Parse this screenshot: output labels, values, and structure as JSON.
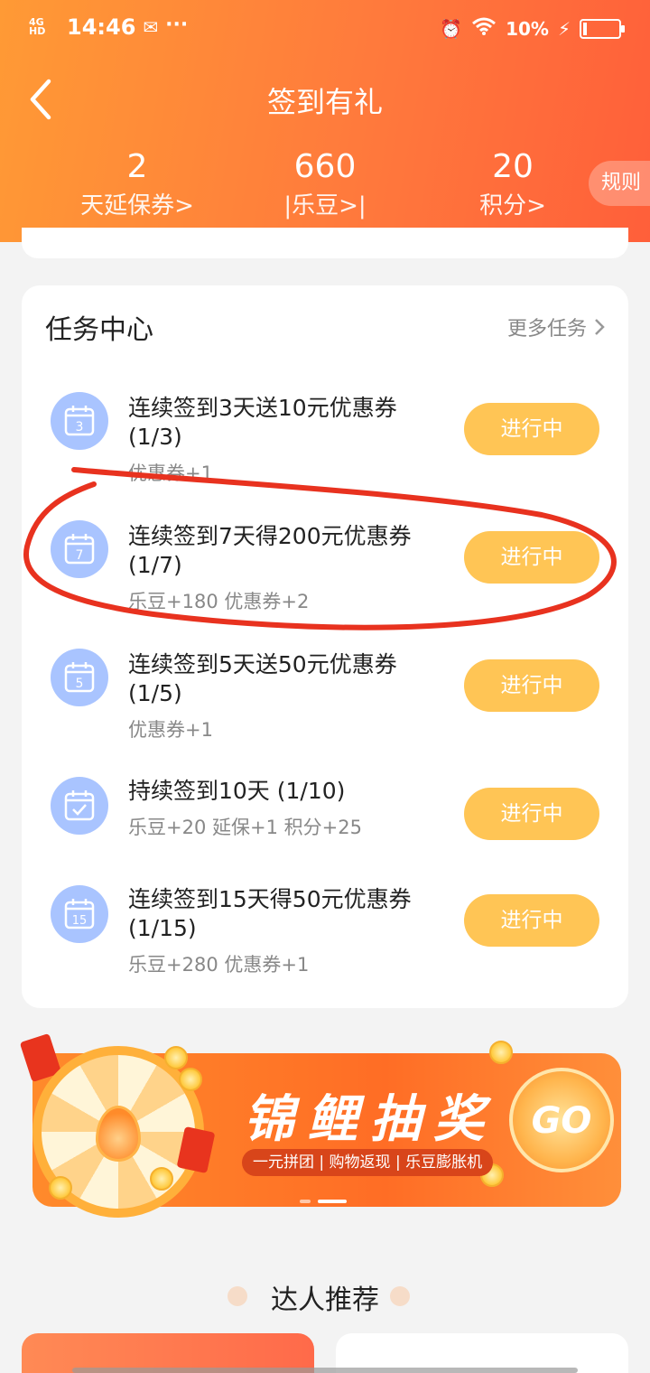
{
  "status_bar": {
    "network": "4G HD",
    "time": "14:46",
    "more": "···",
    "battery_text": "10%",
    "battery_level": 0.1
  },
  "header": {
    "title": "签到有礼",
    "stats": [
      {
        "value": "2",
        "label": "天延保券>"
      },
      {
        "value": "660",
        "label": "|乐豆>|"
      },
      {
        "value": "20",
        "label": "积分>"
      }
    ],
    "rules_label": "规则"
  },
  "task_center": {
    "title": "任务中心",
    "more_label": "更多任务",
    "tasks": [
      {
        "icon": "calendar-3-icon",
        "icon_num": "3",
        "title": "连续签到3天送10元优惠券 (1/3)",
        "reward": "优惠券+1",
        "status": "进行中"
      },
      {
        "icon": "calendar-7-icon",
        "icon_num": "7",
        "title": "连续签到7天得200元优惠券 (1/7)",
        "reward": "乐豆+180 优惠券+2",
        "status": "进行中"
      },
      {
        "icon": "calendar-5-icon",
        "icon_num": "5",
        "title": "连续签到5天送50元优惠券 (1/5)",
        "reward": "优惠券+1",
        "status": "进行中"
      },
      {
        "icon": "calendar-check-icon",
        "icon_num": "",
        "title": "持续签到10天 (1/10)",
        "reward": "乐豆+20 延保+1 积分+25",
        "status": "进行中"
      },
      {
        "icon": "calendar-15-icon",
        "icon_num": "15",
        "title": "连续签到15天得50元优惠券 (1/15)",
        "reward": "乐豆+280 优惠券+1",
        "status": "进行中"
      }
    ]
  },
  "banner": {
    "title": "锦鲤抽奖",
    "subtitle": "一元拼团 | 购物返现 | 乐豆膨胀机",
    "go_label": "GO"
  },
  "recommend": {
    "title": "达人推荐"
  },
  "colors": {
    "header_start": "#ff9a35",
    "header_end": "#ff5f3a",
    "status_button": "#ffc555",
    "icon_bg": "#a9c4ff",
    "annotation_red": "#e8321f"
  }
}
